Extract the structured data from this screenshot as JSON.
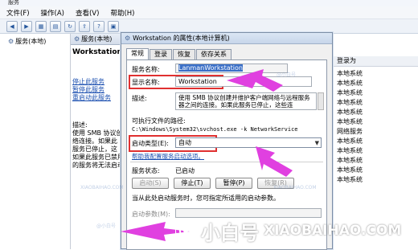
{
  "window": {
    "title": "服务"
  },
  "menu": [
    "文件(F)",
    "操作(A)",
    "查看(V)",
    "帮助(H)"
  ],
  "tree": {
    "root": "服务(本地)"
  },
  "services_panel": {
    "header": "服务(本地)",
    "service_name": "Workstation",
    "stop_link": "停止此服务",
    "pause_link": "暂停此服务",
    "restart_link": "重启动此服务",
    "desc_label": "描述:",
    "desc_lines": [
      "使用 SMB 协议创",
      "络连接。如果此",
      "服务已停止，这",
      "如果此服务已禁用",
      "的服务将无法启动"
    ]
  },
  "right_list": {
    "header": "登录为",
    "rows": [
      "本地系统",
      "本地系统",
      "本地系统",
      "本地系统",
      "本地系统",
      "本地系统",
      "网络服务",
      "本地系统",
      "本地系统",
      "本地系统",
      "本地系统",
      "本地系统"
    ]
  },
  "dialog": {
    "title": "Workstation 的属性(本地计算机)",
    "tabs": [
      "常规",
      "登录",
      "恢复",
      "依存关系"
    ],
    "service_name_label": "服务名称:",
    "service_name_value": "LanmanWorkstation",
    "display_name_label": "显示名称:",
    "display_name_value": "Workstation",
    "description_label": "描述:",
    "description_text": "使用 SMB 协议创建并维护客户端网络与远程服务器之间的连接。如果此服务已停止，这些连",
    "path_label": "可执行文件的路径:",
    "path_value": "C:\\Windows\\System32\\svchost.exe -k NetworkService",
    "startup_type_label": "启动类型(E):",
    "startup_type_value": "自动",
    "help_link": "帮助我配置服务启动选项。",
    "status_label": "服务状态:",
    "status_value": "已启动",
    "buttons": {
      "start": "启动(S)",
      "stop": "停止(T)",
      "pause": "暂停(P)",
      "resume": "恢复(R)"
    },
    "note": "当从此处启动服务时，您可指定所适用的启动参数。",
    "params_label": "启动参数(M):"
  },
  "watermark": {
    "brand_cn": "小白号",
    "brand_en": "XIAOBAIHAO.COM",
    "small_cn": "@小白号",
    "small_en": "XIAOBAIHAO.COM"
  },
  "colors": {
    "highlight_box": "#e03030",
    "arrow": "#e040e0",
    "selection": "#3a6fc7"
  }
}
